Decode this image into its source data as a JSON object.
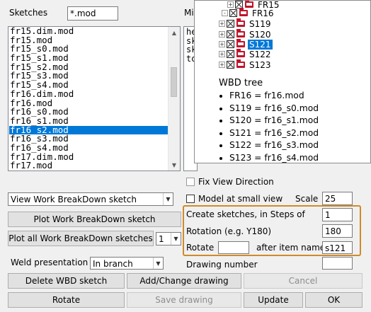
{
  "sketches": {
    "label": "Sketches",
    "filter_value": "*.mod",
    "items": [
      "fr15.dim.mod",
      "fr15.mod",
      "fr15_s0.mod",
      "fr15_s1.mod",
      "fr15_s2.mod",
      "fr15_s3.mod",
      "fr15_s4.mod",
      "fr16.dim.mod",
      "fr16.mod",
      "fr16_s0.mod",
      "fr16_s1.mod",
      "fr16_s2.mod",
      "fr16_s3.mod",
      "fr16_s4.mod",
      "fr17.dim.mod",
      "fr17.mod"
    ],
    "selected": "fr16_s2.mod"
  },
  "misc": {
    "label_partial": "Mis",
    "content_partial": [
      "he",
      "sk",
      "sk",
      "to"
    ]
  },
  "tree": {
    "nodes": [
      {
        "label": "FR15",
        "level": 1,
        "expander": "+"
      },
      {
        "label": "FR16",
        "level": 0,
        "expander": "-"
      },
      {
        "label": "S119",
        "level": 1,
        "expander": "+"
      },
      {
        "label": "S120",
        "level": 1,
        "expander": "+"
      },
      {
        "label": "S121",
        "level": 1,
        "expander": "+",
        "selected": true
      },
      {
        "label": "S122",
        "level": 1,
        "expander": "+"
      },
      {
        "label": "S123",
        "level": 1,
        "expander": "+"
      }
    ],
    "wbd_title": "WBD tree",
    "wbd_items": [
      "FR16 = fr16.mod",
      "S119 = fr16_s0.mod",
      "S120 = fr16_s1.mod",
      "S121 = fr16_s2.mod",
      "S122 = fr16_s3.mod",
      "S123 = fr16_s4.mod"
    ]
  },
  "options": {
    "fix_view_direction": "Fix View Direction",
    "model_small_view": "Model at small view",
    "scale_label": "Scale",
    "scale_value": "25"
  },
  "view_combo": "View Work BreakDown sketch",
  "buttons": {
    "plot_wbd": "Plot Work BreakDown sketch",
    "plot_all_wbd": "Plot all Work BreakDown sketches",
    "plot_all_count": "1",
    "delete_wbd": "Delete WBD sketch",
    "add_change": "Add/Change drawing",
    "cancel": "Cancel",
    "rotate": "Rotate",
    "save_drawing": "Save drawing",
    "update": "Update",
    "ok": "OK"
  },
  "weld": {
    "label": "Weld presentation",
    "value": "In branch"
  },
  "create_group": {
    "steps_label": "Create sketches, in Steps of",
    "steps_value": "1",
    "rotation_label": "Rotation (e.g. Y180)",
    "rotation_value": "180",
    "rotate_label": "Rotate",
    "rotate_value": "",
    "after_label": "after item name",
    "after_value": "s121"
  },
  "drawing_number_label": "Drawing number",
  "colors": {
    "accent": "#0078d7",
    "group_border": "#d08a2a",
    "folder": "#c0142a"
  }
}
